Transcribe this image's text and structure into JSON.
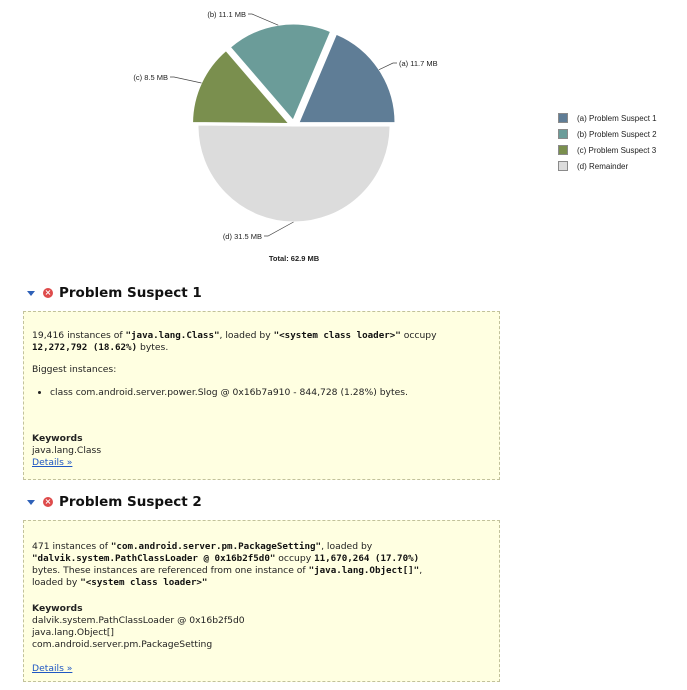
{
  "chart_data": {
    "type": "pie",
    "slices": [
      {
        "label": "(a)",
        "value_label": "11.7 MB",
        "value": 11.7,
        "color": "#5f7d96",
        "legend": "Problem Suspect 1"
      },
      {
        "label": "(b)",
        "value_label": "11.1 MB",
        "value": 11.1,
        "color": "#6b9c99",
        "legend": "Problem Suspect 2"
      },
      {
        "label": "(c)",
        "value_label": "8.5 MB",
        "value": 8.5,
        "color": "#7a8f4e",
        "legend": "Problem Suspect 3"
      },
      {
        "label": "(d)",
        "value_label": "31.5 MB",
        "value": 31.5,
        "color": "#dcdcdc",
        "legend": "Remainder"
      }
    ],
    "total_label": "Total: 62.9 MB"
  },
  "legend_items": [
    {
      "text": "(a)  Problem Suspect 1",
      "color": "#5f7d96"
    },
    {
      "text": "(b)  Problem Suspect 2",
      "color": "#6b9c99"
    },
    {
      "text": "(c)  Problem Suspect 3",
      "color": "#7a8f4e"
    },
    {
      "text": "(d)  Remainder",
      "color": "#dcdcdc"
    }
  ],
  "suspect1": {
    "title": "Problem Suspect 1",
    "p1_a": "19,416 instances of ",
    "p1_b": "\"java.lang.Class\"",
    "p1_c": ", loaded by ",
    "p1_d": "\"<system class loader>\"",
    "p1_e": " occupy",
    "p1_f": "12,272,792 (18.62%)",
    "p1_g": " bytes.",
    "biggest_label": "Biggest instances:",
    "bullet": "class com.android.server.power.Slog @ 0x16b7a910 - 844,728 (1.28%) bytes.",
    "keywords_title": "Keywords",
    "keywords": [
      "java.lang.Class"
    ],
    "details": "Details »"
  },
  "suspect2": {
    "title": "Problem Suspect 2",
    "p1_a": "471 instances of ",
    "p1_b": "\"com.android.server.pm.PackageSetting\"",
    "p1_c": ", loaded by",
    "p1_d": "\"dalvik.system.PathClassLoader @ 0x16b2f5d0\"",
    "p1_e": " occupy ",
    "p1_f": "11,670,264 (17.70%)",
    "p1_g": "bytes. These instances are referenced from one instance of ",
    "p1_h": "\"java.lang.Object[]\"",
    "p1_i": ",",
    "p1_j": "loaded by ",
    "p1_k": "\"<system class loader>\"",
    "keywords_title": "Keywords",
    "keywords": [
      "dalvik.system.PathClassLoader @ 0x16b2f5d0",
      "java.lang.Object[]",
      "com.android.server.pm.PackageSetting"
    ],
    "details": "Details »"
  }
}
